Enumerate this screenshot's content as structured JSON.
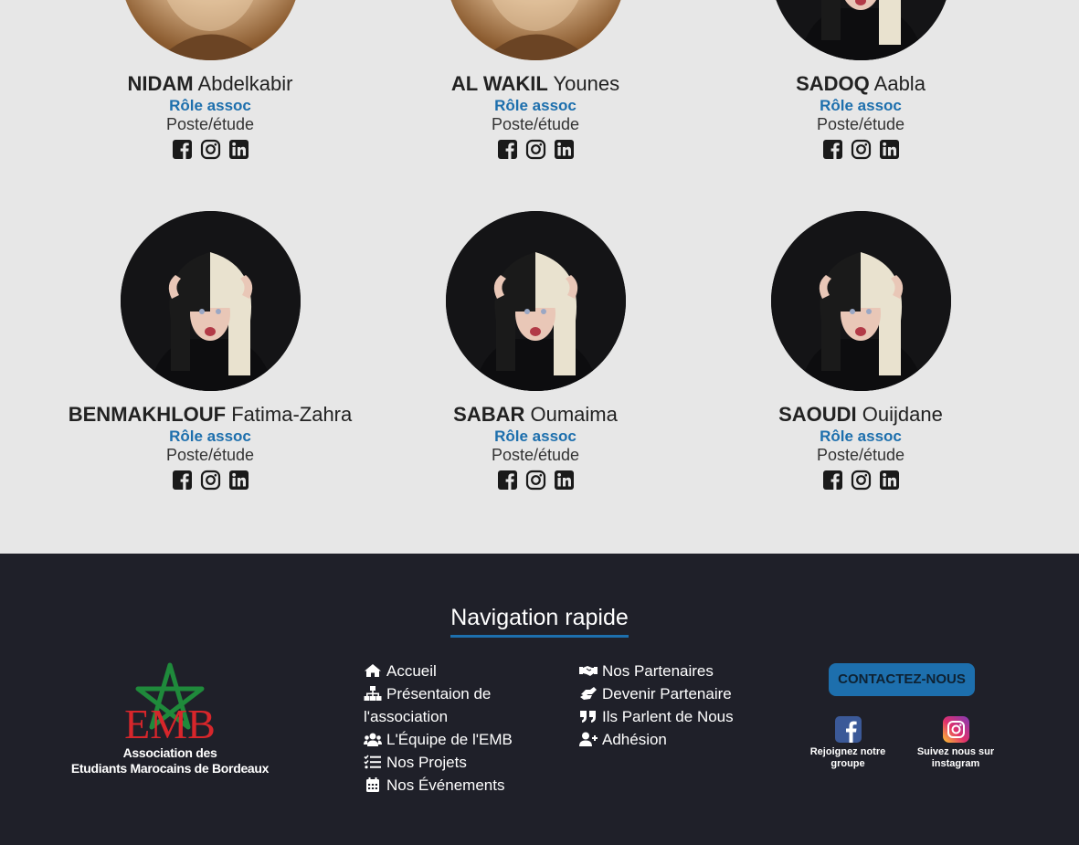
{
  "members": [
    {
      "last": "NIDAM",
      "first": "Abdelkabir",
      "role": "Rôle assoc",
      "poste": "Poste/étude",
      "photo": "old-man"
    },
    {
      "last": "AL WAKIL",
      "first": "Younes",
      "role": "Rôle assoc",
      "poste": "Poste/étude",
      "photo": "old-man"
    },
    {
      "last": "SADOQ",
      "first": "Aabla",
      "role": "Rôle assoc",
      "poste": "Poste/étude",
      "photo": "woman"
    },
    {
      "last": "BENMAKHLOUF",
      "first": "Fatima-Zahra",
      "role": "Rôle assoc",
      "poste": "Poste/étude",
      "photo": "woman"
    },
    {
      "last": "SABAR",
      "first": "Oumaima",
      "role": "Rôle assoc",
      "poste": "Poste/étude",
      "photo": "woman"
    },
    {
      "last": "SAOUDI",
      "first": "Ouijdane",
      "role": "Rôle assoc",
      "poste": "Poste/étude",
      "photo": "woman"
    }
  ],
  "social_icons": [
    "facebook-square-icon",
    "instagram-icon",
    "linkedin-icon"
  ],
  "footer": {
    "nav_title": "Navigation rapide",
    "logo": {
      "mark": "EMB",
      "line1": "Association des",
      "line2": "Etudiants Marocains de Bordeaux"
    },
    "col1": [
      {
        "icon": "home-icon",
        "label": "Accueil"
      },
      {
        "icon": "sitemap-icon",
        "label": "Présentaion de l'association"
      },
      {
        "icon": "users-icon",
        "label": "L'Équipe de l'EMB"
      },
      {
        "icon": "tasks-icon",
        "label": "Nos Projets"
      },
      {
        "icon": "calendar-icon",
        "label": "Nos Événements"
      }
    ],
    "col2": [
      {
        "icon": "handshake-icon",
        "label": "Nos Partenaires"
      },
      {
        "icon": "hands-helping-icon",
        "label": "Devenir Partenaire"
      },
      {
        "icon": "quote-icon",
        "label": "Ils Parlent de Nous"
      },
      {
        "icon": "user-plus-icon",
        "label": "Adhésion"
      }
    ],
    "contact_label": "CONTACTEZ-NOUS",
    "facebook_label": "Rejoignez notre groupe",
    "instagram_label": "Suivez nous sur instagram"
  },
  "colors": {
    "accent": "#1d6fad",
    "page_bg": "#e7e7e7",
    "footer_bg": "#1f2029",
    "logo_red": "#d7262b",
    "logo_green": "#1f8a3b"
  }
}
